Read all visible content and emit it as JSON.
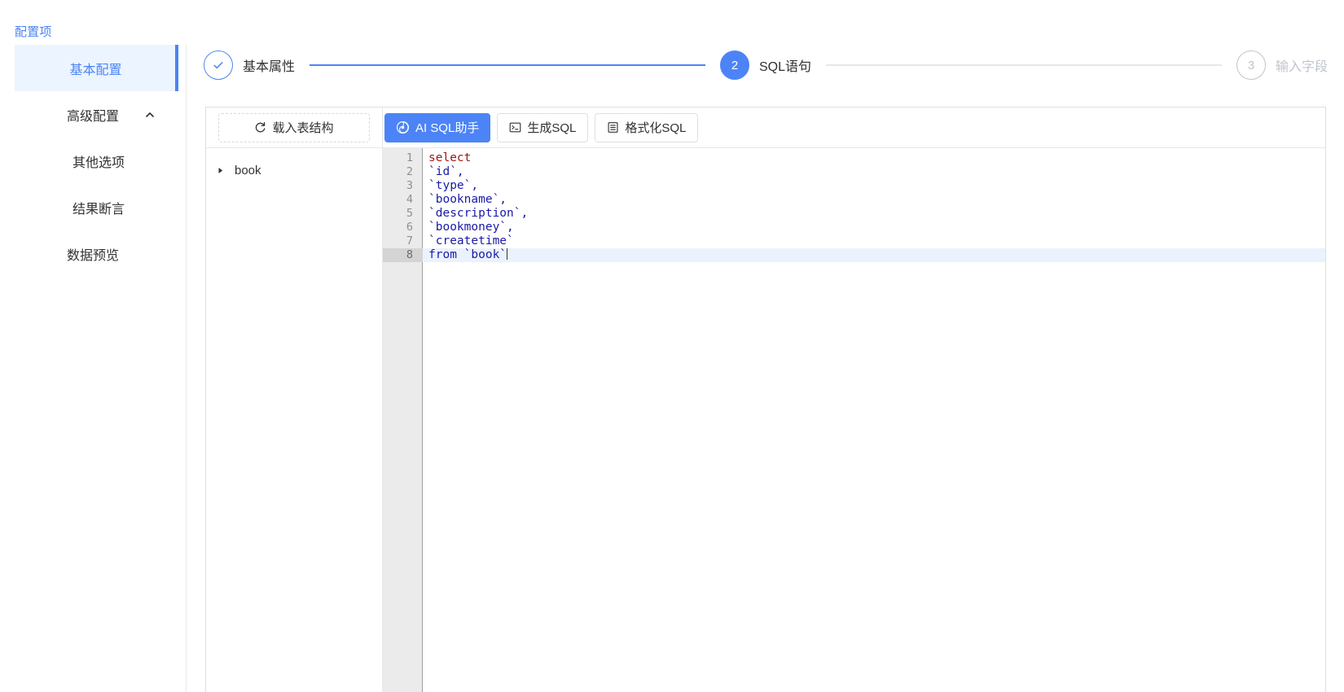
{
  "breadcrumb": {
    "label": "配置项"
  },
  "sidebar": {
    "items": [
      {
        "label": "基本配置",
        "state": "active",
        "level": 1,
        "caret": null
      },
      {
        "label": "高级配置",
        "state": "normal",
        "level": 1,
        "caret": "chevron-up-icon"
      },
      {
        "label": "其他选项",
        "state": "normal",
        "level": 2,
        "caret": null
      },
      {
        "label": "结果断言",
        "state": "normal",
        "level": 2,
        "caret": null
      },
      {
        "label": "数据预览",
        "state": "normal",
        "level": 1,
        "caret": null
      }
    ]
  },
  "stepper": {
    "steps": [
      {
        "number": "1",
        "marker": "check-icon",
        "label": "基本属性",
        "state": "done"
      },
      {
        "number": "2",
        "marker": "2",
        "label": "SQL语句",
        "state": "active"
      },
      {
        "number": "3",
        "marker": "3",
        "label": "输入字段",
        "state": "wait"
      }
    ],
    "connector_filled_color": "#4c84f7",
    "connector_empty_color": "#e4e7ed"
  },
  "toolbar": {
    "load_schema": {
      "label": "载入表结构",
      "icon": "refresh-icon"
    },
    "ai_sql": {
      "label": "AI SQL助手",
      "icon": "ai-swirl-icon"
    },
    "generate_sql": {
      "label": "生成SQL",
      "icon": "console-icon"
    },
    "format_sql": {
      "label": "格式化SQL",
      "icon": "list-document-icon"
    }
  },
  "tree": {
    "nodes": [
      {
        "label": "book",
        "expanded": false,
        "caret": "caret-right-icon"
      }
    ]
  },
  "editor": {
    "language": "sql",
    "active_line": 8,
    "lines": [
      {
        "no": "1",
        "text": "select",
        "type": "keyword"
      },
      {
        "no": "2",
        "text": "`id`,",
        "type": "token"
      },
      {
        "no": "3",
        "text": "`type`,",
        "type": "token"
      },
      {
        "no": "4",
        "text": "`bookname`,",
        "type": "token"
      },
      {
        "no": "5",
        "text": "`description`,",
        "type": "token"
      },
      {
        "no": "6",
        "text": "`bookmoney`,",
        "type": "token"
      },
      {
        "no": "7",
        "text": "`createtime`",
        "type": "token"
      },
      {
        "no": "8",
        "text": "from `book`",
        "type": "mixed"
      }
    ],
    "full_sql": "select\n`id`,\n`type`,\n`bookname`,\n`description`,\n`bookmoney`,\n`createtime`\nfrom `book`"
  },
  "colors": {
    "accent": "#4c84f7",
    "active_bg": "#ecf5ff",
    "border": "#dcdfe6",
    "gutter": "#ebebeb",
    "active_line": "#eaf2fd",
    "muted": "#c0c4cc"
  }
}
